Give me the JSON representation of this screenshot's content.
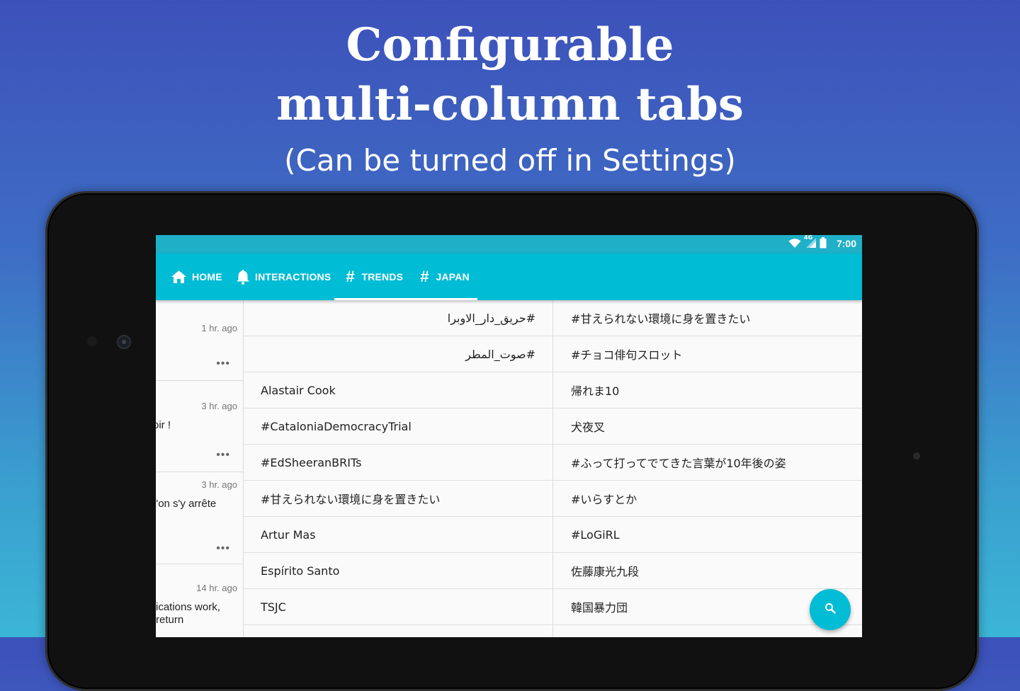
{
  "promo": {
    "line1": "Configurable",
    "line2": "multi-column tabs",
    "subtitle": "(Can be turned off in Settings)"
  },
  "status_bar": {
    "time": "7:00",
    "network": "4G",
    "icons": [
      "wifi-icon",
      "signal-icon",
      "battery-icon"
    ]
  },
  "tabs": [
    {
      "label": "HOME",
      "icon": "home-icon"
    },
    {
      "label": "INTERACTIONS",
      "icon": "bell-icon"
    },
    {
      "label": "TRENDS",
      "icon": "hash-icon",
      "selected": true
    },
    {
      "label": "JAPAN",
      "icon": "hash-icon"
    }
  ],
  "timeline": [
    {
      "ago": "1 hr. ago",
      "text": ""
    },
    {
      "ago": "3 hr. ago",
      "text": "oir !"
    },
    {
      "ago": "3 hr. ago",
      "text": "l'on s'y arrête"
    },
    {
      "ago": "14 hr. ago",
      "text": "ications work,",
      "text2": "return"
    }
  ],
  "more_glyph": "•••",
  "trends_left": [
    "#حريق_دار_الاوبرا",
    "#صوت_المطر",
    "Alastair Cook",
    "#CataloniaDemocracyTrial",
    "#EdSheeranBRITs",
    "#甘えられない環境に身を置きたい",
    "Artur Mas",
    "Espírito Santo",
    "TSJC"
  ],
  "trends_right": [
    "#甘えられない環境に身を置きたい",
    "#チョコ俳句スロット",
    "帰れま10",
    "犬夜叉",
    "#ふって打ってでてきた言葉が10年後の姿",
    "#いらすとか",
    "#LoGiRL",
    "佐藤康光九段",
    "韓国暴力団"
  ],
  "fab": {
    "icon": "search-icon"
  },
  "colors": {
    "tabbar": "#00bcd4",
    "statusbar": "#1fb0c8",
    "background_top": "#3d51ba",
    "background_bottom": "#3bb6d6"
  }
}
